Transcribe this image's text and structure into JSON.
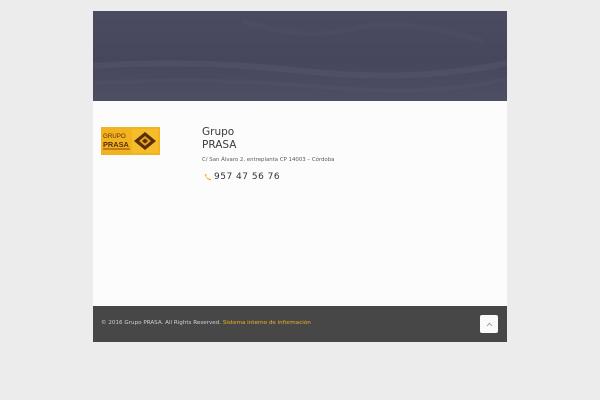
{
  "company": {
    "name_line1": "Grupo",
    "name_line2": "PRASA",
    "address": "C/ San Álvaro 2, entreplanta CP 14003 – Córdoba",
    "phone": "957 47 56 76",
    "logo_text_line1": "GRUPO",
    "logo_text_line2": "PRASA"
  },
  "footer": {
    "copyright": "© 2016 Grupo PRASA. All Rights Reserved.",
    "link_label": "Sistema interno de información"
  },
  "icons": {
    "phone": "phone-icon",
    "back_to_top": "chevron-up-icon"
  },
  "colors": {
    "accent": "#f3b21f",
    "hero": "#47485e",
    "footer": "#474747"
  }
}
